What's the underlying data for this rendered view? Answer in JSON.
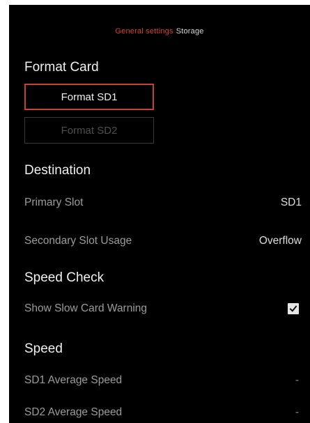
{
  "breadcrumb": {
    "parent": "General settings",
    "current": "Storage"
  },
  "format_card": {
    "title": "Format Card",
    "sd1_label": "Format SD1",
    "sd2_label": "Format SD2"
  },
  "destination": {
    "title": "Destination",
    "primary_label": "Primary Slot",
    "primary_value": "SD1",
    "secondary_label": "Secondary Slot Usage",
    "secondary_value": "Overflow"
  },
  "speed_check": {
    "title": "Speed Check",
    "warning_label": "Show Slow Card Warning",
    "warning_checked": true
  },
  "speed": {
    "title": "Speed",
    "sd1_label": "SD1 Average Speed",
    "sd1_value": "-",
    "sd2_label": "SD2 Average Speed",
    "sd2_value": "-"
  },
  "colors": {
    "accent": "#c2442c",
    "background": "#000000"
  }
}
